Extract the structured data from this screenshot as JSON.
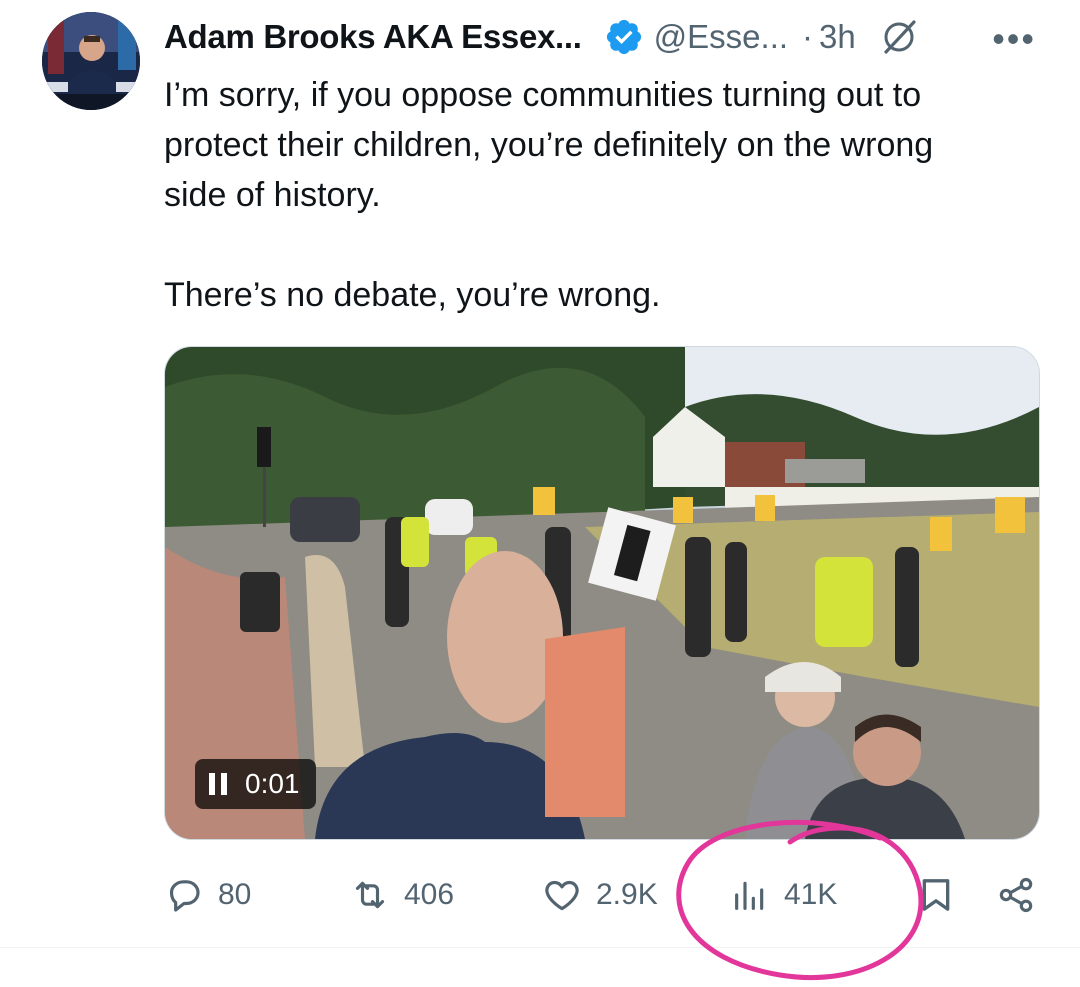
{
  "tweet": {
    "author_name": "Adam Brooks AKA Essex...",
    "handle": "@Esse...",
    "separator": "·",
    "time": "3h",
    "more_label": "•••",
    "text_lines": [
      "I’m sorry, if you oppose communities turning out to",
      "protect their children, you’re definitely on the wrong",
      "side of history.",
      "There’s no debate, you’re wrong."
    ]
  },
  "media": {
    "type": "video",
    "timestamp": "0:01"
  },
  "actions": {
    "replies": "80",
    "reposts": "406",
    "likes": "2.9K",
    "views": "41K"
  },
  "icons": {
    "verified": "verified-badge-icon",
    "grok": "grok-icon",
    "more": "more-icon",
    "reply": "reply-icon",
    "repost": "repost-icon",
    "like": "heart-icon",
    "views": "views-icon",
    "bookmark": "bookmark-icon",
    "share": "share-icon"
  },
  "colors": {
    "accent": "#1d9bf0",
    "muted": "#536471",
    "annotation": "#e2369a"
  }
}
